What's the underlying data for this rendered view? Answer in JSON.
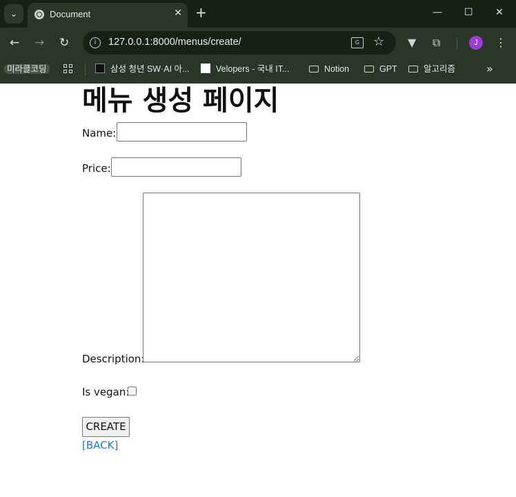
{
  "browser": {
    "tab_title": "Document",
    "url": "127.0.0.1:8000/menus/create/",
    "profile_initial": "J",
    "bookmarks": [
      {
        "label": "미라클코딩",
        "kind": "chip"
      },
      {
        "label": "삼성 청년 SW·AI 아...",
        "kind": "site"
      },
      {
        "label": "Velopers - 국내 IT...",
        "kind": "site"
      },
      {
        "label": "Notion",
        "kind": "folder"
      },
      {
        "label": "GPT",
        "kind": "folder"
      },
      {
        "label": "알고리즘",
        "kind": "folder"
      }
    ]
  },
  "page": {
    "heading": "메뉴 생성 페이지",
    "form": {
      "name_label": "Name:",
      "name_value": "",
      "price_label": "Price:",
      "price_value": "",
      "description_label": "Description:",
      "description_value": "",
      "vegan_label": "Is vegan:",
      "vegan_checked": false,
      "submit_label": "CREATE"
    },
    "back_link": "[BACK]"
  },
  "colors": {
    "titlebar": "#172217",
    "toolbar": "#2a362a",
    "link": "#1a73e8",
    "profile": "#9b3fd1"
  }
}
